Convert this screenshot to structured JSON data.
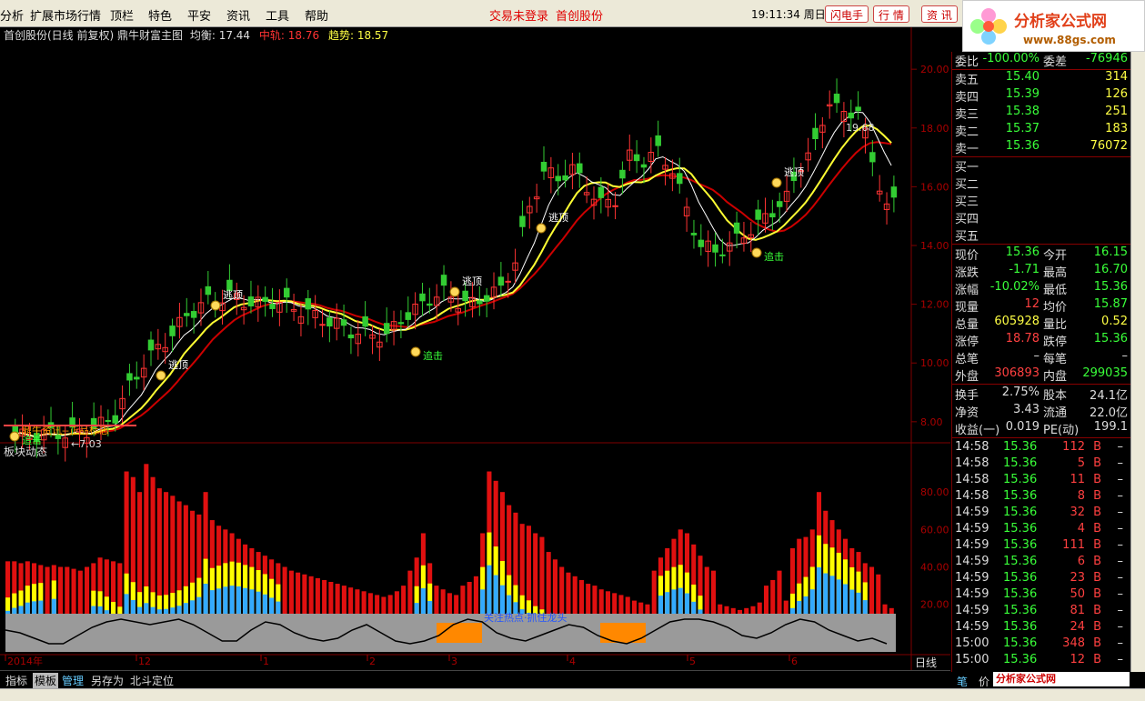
{
  "menu": [
    "分析",
    "扩展市场行情",
    "顶栏",
    "特色",
    "平安",
    "资讯",
    "工具",
    "帮助"
  ],
  "status": {
    "login": "交易未登录",
    "stock": "首创股份"
  },
  "clock": "19:11:34 周日",
  "toolbar_buttons": [
    "闪电手",
    "行 情",
    "资 讯"
  ],
  "logo": {
    "title": "分析家公式网",
    "url": "www.88gs.com"
  },
  "chart_info": {
    "title": "首创股份(日线 前复权) 鼎牛财富主图",
    "avg_label": "均衡:",
    "avg": "17.44",
    "mid_label": "中轨:",
    "mid": "18.76",
    "trend_label": "趋势:",
    "trend": "18.57"
  },
  "chart_data": [
    {
      "type": "candlestick",
      "title": "首创股份(日线 前复权) 鼎牛财富主图",
      "y_ticks": [
        "20.00",
        "18.00",
        "16.00",
        "14.00",
        "12.00",
        "10.00",
        "8.00"
      ],
      "ylim": [
        7.5,
        20.5
      ],
      "x_ticks": [
        "2014年",
        "12",
        "1",
        "2",
        "3",
        "4",
        "5",
        "6"
      ],
      "annotations": {
        "high": "19.68",
        "low": "7.03",
        "signals": [
          "逃顶",
          "逃顶",
          "逃顶",
          "逃顶",
          "逃顶",
          "追击",
          "追击",
          "追击"
        ],
        "text": "鼎牛资讯--正品标志"
      },
      "close_path": [
        7.5,
        7.5,
        7.6,
        7.6,
        7.6,
        7.7,
        7.9,
        8.2,
        9.2,
        10.0,
        10.5,
        11.0,
        11.6,
        12.0,
        12.2,
        12.3,
        12.1,
        12.0,
        12.1,
        12.0,
        11.8,
        11.6,
        11.4,
        11.2,
        11.0,
        11.0,
        10.9,
        11.5,
        11.8,
        12.2,
        12.4,
        12.1,
        12.0,
        12.3,
        12.5,
        13.5,
        15.3,
        16.5,
        16.3,
        16.6,
        16.0,
        15.4,
        15.6,
        17.0,
        16.9,
        17.2,
        16.6,
        15.2,
        14.0,
        13.8,
        14.0,
        14.4,
        14.7,
        15.2,
        15.6,
        16.8,
        17.4,
        19.0,
        18.4,
        18.7,
        16.8,
        15.4
      ]
    },
    {
      "type": "bar",
      "title": "板块动态",
      "y_ticks": [
        "80.00",
        "60.00",
        "40.00",
        "20.00"
      ],
      "ylim": [
        15,
        100
      ],
      "series": [
        {
          "name": "red",
          "values": [
            43,
            43,
            42,
            43,
            42,
            41,
            40,
            41,
            40,
            40,
            39,
            38,
            40,
            42,
            45,
            44,
            43,
            42,
            91,
            88,
            80,
            95,
            88,
            82,
            80,
            78,
            75,
            73,
            70,
            68,
            80,
            65,
            62,
            60,
            58,
            55,
            52,
            50,
            48,
            46,
            44,
            42,
            40,
            38,
            37,
            36,
            35,
            34,
            33,
            32,
            31,
            30,
            29,
            28,
            27,
            26,
            25,
            24,
            25,
            27,
            30,
            38,
            45,
            58,
            42,
            30,
            28,
            26,
            25,
            30,
            32,
            35,
            58,
            91,
            86,
            80,
            73,
            69,
            63,
            62,
            58,
            56,
            48,
            44,
            40,
            37,
            35,
            33,
            31,
            30,
            28,
            27,
            26,
            25,
            24,
            22,
            21,
            20,
            38,
            45,
            50,
            55,
            60,
            58,
            52,
            46,
            40,
            38,
            20,
            19,
            18,
            17,
            18,
            19,
            21,
            30,
            33,
            38,
            22,
            50,
            55,
            56,
            60,
            80,
            70,
            65,
            60,
            55,
            50,
            48,
            42,
            40,
            36,
            20,
            18
          ]
        }
      ]
    },
    {
      "type": "line",
      "title": "关注热点·抓住龙头",
      "values": [
        0.6,
        0.5,
        0.3,
        0.1,
        0.1,
        0.4,
        0.7,
        0.9,
        1.0,
        0.9,
        0.8,
        0.9,
        1.0,
        0.8,
        0.5,
        0.2,
        0.2,
        0.6,
        0.9,
        0.8,
        0.5,
        0.3,
        0.2,
        0.3,
        0.6,
        0.8,
        0.5,
        0.2,
        0.1,
        0.2,
        0.4,
        0.8,
        1.0,
        0.9,
        0.5,
        0.3,
        0.2,
        0.4,
        0.6,
        0.8,
        0.7,
        0.4,
        0.2,
        0.1,
        0.3,
        0.6,
        0.9,
        1.0,
        1.0,
        0.9,
        0.7,
        0.4,
        0.3,
        0.5,
        0.8,
        1.0,
        0.9,
        0.6,
        0.4,
        0.2,
        0.3,
        0.1
      ]
    }
  ],
  "panel_title": "板块动态",
  "panel_banner": "关注热点·抓住龙头",
  "bottom_tabs": [
    "指标",
    "模板",
    "管理",
    "另存为",
    "北斗定位"
  ],
  "right_tabs": [
    "日线",
    "笔",
    "价"
  ],
  "quote": {
    "weibi_label": "委比",
    "weibi": "-100.00%",
    "weicha_label": "委差",
    "weicha": "-76946",
    "asks": [
      {
        "label": "卖五",
        "price": "15.40",
        "vol": "314"
      },
      {
        "label": "卖四",
        "price": "15.39",
        "vol": "126"
      },
      {
        "label": "卖三",
        "price": "15.38",
        "vol": "251"
      },
      {
        "label": "卖二",
        "price": "15.37",
        "vol": "183"
      },
      {
        "label": "卖一",
        "price": "15.36",
        "vol": "76072"
      }
    ],
    "bids": [
      "买一",
      "买二",
      "买三",
      "买四",
      "买五"
    ],
    "stats": [
      {
        "l1": "现价",
        "v1": "15.36",
        "c1": "g",
        "l2": "今开",
        "v2": "16.15",
        "c2": "g"
      },
      {
        "l1": "涨跌",
        "v1": "-1.71",
        "c1": "g",
        "l2": "最高",
        "v2": "16.70",
        "c2": "g"
      },
      {
        "l1": "涨幅",
        "v1": "-10.02%",
        "c1": "g",
        "l2": "最低",
        "v2": "15.36",
        "c2": "g"
      },
      {
        "l1": "现量",
        "v1": "12",
        "c1": "r",
        "l2": "均价",
        "v2": "15.87",
        "c2": "g"
      },
      {
        "l1": "总量",
        "v1": "605928",
        "c1": "y",
        "l2": "量比",
        "v2": "0.52",
        "c2": "y"
      },
      {
        "l1": "涨停",
        "v1": "18.78",
        "c1": "r",
        "l2": "跌停",
        "v2": "15.36",
        "c2": "g"
      },
      {
        "l1": "总笔",
        "v1": "–",
        "c1": "w",
        "l2": "每笔",
        "v2": "–",
        "c2": "w"
      },
      {
        "l1": "外盘",
        "v1": "306893",
        "c1": "r",
        "l2": "内盘",
        "v2": "299035",
        "c2": "g"
      }
    ],
    "stats2": [
      {
        "l1": "换手",
        "v1": "2.75%",
        "l2": "股本",
        "v2": "24.1亿"
      },
      {
        "l1": "净资",
        "v1": "3.43",
        "l2": "流通",
        "v2": "22.0亿"
      },
      {
        "l1": "收益(一)",
        "v1": "0.019",
        "l2": "PE(动)",
        "v2": "199.1"
      }
    ],
    "ticks": [
      {
        "t": "14:58",
        "p": "15.36",
        "v": "112",
        "b": "B",
        "d": "–"
      },
      {
        "t": "14:58",
        "p": "15.36",
        "v": "5",
        "b": "B",
        "d": "–"
      },
      {
        "t": "14:58",
        "p": "15.36",
        "v": "11",
        "b": "B",
        "d": "–"
      },
      {
        "t": "14:58",
        "p": "15.36",
        "v": "8",
        "b": "B",
        "d": "–"
      },
      {
        "t": "14:59",
        "p": "15.36",
        "v": "32",
        "b": "B",
        "d": "–"
      },
      {
        "t": "14:59",
        "p": "15.36",
        "v": "4",
        "b": "B",
        "d": "–"
      },
      {
        "t": "14:59",
        "p": "15.36",
        "v": "111",
        "b": "B",
        "d": "–"
      },
      {
        "t": "14:59",
        "p": "15.36",
        "v": "6",
        "b": "B",
        "d": "–"
      },
      {
        "t": "14:59",
        "p": "15.36",
        "v": "23",
        "b": "B",
        "d": "–"
      },
      {
        "t": "14:59",
        "p": "15.36",
        "v": "50",
        "b": "B",
        "d": "–"
      },
      {
        "t": "14:59",
        "p": "15.36",
        "v": "81",
        "b": "B",
        "d": "–"
      },
      {
        "t": "14:59",
        "p": "15.36",
        "v": "24",
        "b": "B",
        "d": "–"
      },
      {
        "t": "15:00",
        "p": "15.36",
        "v": "348",
        "b": "B",
        "d": "–"
      },
      {
        "t": "15:00",
        "p": "15.36",
        "v": "12",
        "b": "B",
        "d": "–"
      }
    ]
  },
  "footer_logo": "分析家公式网www.88gs.com"
}
